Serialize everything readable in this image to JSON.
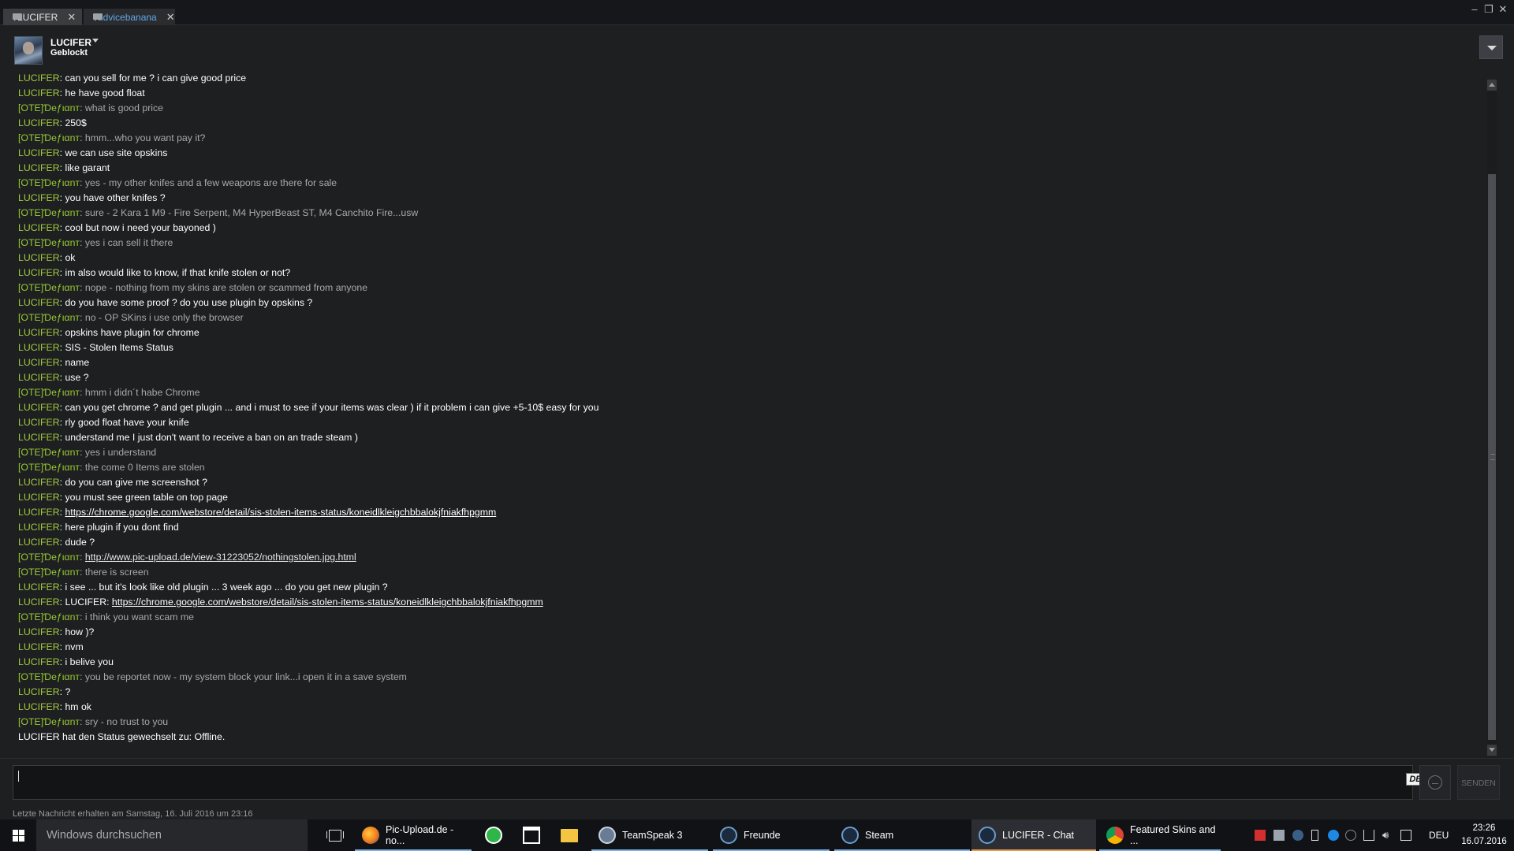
{
  "tabs": [
    {
      "label": "LUCIFER"
    },
    {
      "label": "advicebanana"
    }
  ],
  "header": {
    "name": "LUCIFER",
    "status": "Geblockt"
  },
  "messages": [
    {
      "n": "LUCIFER",
      "t": "can you sell for me ? i can give good price",
      "me": false
    },
    {
      "n": "LUCIFER",
      "t": "he have good float",
      "me": false
    },
    {
      "n": "[OTE]Ɗeƒιαnт",
      "t": "what is good price",
      "me": true
    },
    {
      "n": "LUCIFER",
      "t": "250$",
      "me": false
    },
    {
      "n": "[OTE]Ɗeƒιαnт",
      "t": "hmm...who you want pay it?",
      "me": true
    },
    {
      "n": "LUCIFER",
      "t": "we can use site opskins",
      "me": false
    },
    {
      "n": "LUCIFER",
      "t": "like garant",
      "me": false
    },
    {
      "n": "[OTE]Ɗeƒιαnт",
      "t": "yes - my other knifes and a few weapons are there for sale",
      "me": true
    },
    {
      "n": "LUCIFER",
      "t": "you have other knifes ?",
      "me": false
    },
    {
      "n": "[OTE]Ɗeƒιαnт",
      "t": "sure - 2 Kara 1 M9 - Fire Serpent, M4 HyperBeast ST, M4 Canchito Fire...usw",
      "me": true
    },
    {
      "n": "LUCIFER",
      "t": "cool but now i need your bayoned )",
      "me": false
    },
    {
      "n": "[OTE]Ɗeƒιαnт",
      "t": "yes i can sell it there",
      "me": true
    },
    {
      "n": "LUCIFER",
      "t": "ok",
      "me": false
    },
    {
      "n": "LUCIFER",
      "t": "im also would like to know, if that knife stolen or not?",
      "me": false
    },
    {
      "n": "[OTE]Ɗeƒιαnт",
      "t": "nope - nothing from my skins are stolen or scammed from anyone",
      "me": true
    },
    {
      "n": "LUCIFER",
      "t": "do you have some proof ? do you use plugin by opskins ?",
      "me": false
    },
    {
      "n": "[OTE]Ɗeƒιαnт",
      "t": "no - OP SKins i use only the browser",
      "me": true
    },
    {
      "n": "LUCIFER",
      "t": "opskins have plugin for chrome",
      "me": false
    },
    {
      "n": "LUCIFER",
      "t": "SIS - Stolen Items Status",
      "me": false
    },
    {
      "n": "LUCIFER",
      "t": "name",
      "me": false
    },
    {
      "n": "LUCIFER",
      "t": "use ?",
      "me": false
    },
    {
      "n": "[OTE]Ɗeƒιαnт",
      "t": "hmm i didn´t habe Chrome",
      "me": true
    },
    {
      "n": "LUCIFER",
      "t": "can you get chrome ? and get plugin ... and i must to see if your items was clear ) if it problem i can give +5-10$ easy for you",
      "me": false
    },
    {
      "n": "LUCIFER",
      "t": "rly good float have your knife",
      "me": false
    },
    {
      "n": "LUCIFER",
      "t": "understand me I just don't want to receive a ban on an trade steam )",
      "me": false
    },
    {
      "n": "[OTE]Ɗeƒιαnт",
      "t": "yes i understand",
      "me": true
    },
    {
      "n": "[OTE]Ɗeƒιαnт",
      "t": "the come 0 Items are stolen",
      "me": true
    },
    {
      "n": "LUCIFER",
      "t": "do you can give me screenshot ?",
      "me": false
    },
    {
      "n": "LUCIFER",
      "t": "you must see green table on top page",
      "me": false
    },
    {
      "n": "LUCIFER",
      "t": "",
      "link": "https://chrome.google.com/webstore/detail/sis-stolen-items-status/koneidlkleigchbbalokjfniakfhpgmm",
      "me": false
    },
    {
      "n": "LUCIFER",
      "t": "here plugin if you dont find",
      "me": false
    },
    {
      "n": "LUCIFER",
      "t": "dude ?",
      "me": false
    },
    {
      "n": "[OTE]Ɗeƒιαnт",
      "t": "",
      "link": "http://www.pic-upload.de/view-31223052/nothingstolen.jpg.html",
      "me": true
    },
    {
      "n": "[OTE]Ɗeƒιαnт",
      "t": "there is screen",
      "me": true
    },
    {
      "n": "LUCIFER",
      "t": "i see ... but it's look like old plugin ... 3 week ago ... do you get new plugin ?",
      "me": false
    },
    {
      "n": "LUCIFER",
      "t": "LUCIFER: ",
      "link": "https://chrome.google.com/webstore/detail/sis-stolen-items-status/koneidlkleigchbbalokjfniakfhpgmm",
      "me": false
    },
    {
      "n": "[OTE]Ɗeƒιαnт",
      "t": "i think you want scam me",
      "me": true
    },
    {
      "n": "LUCIFER",
      "t": "how )?",
      "me": false
    },
    {
      "n": "LUCIFER",
      "t": "nvm",
      "me": false
    },
    {
      "n": "LUCIFER",
      "t": "i belive you",
      "me": false
    },
    {
      "n": "[OTE]Ɗeƒιαnт",
      "t": "you be reportet now - my system block your link...i open it in a save system",
      "me": true
    },
    {
      "n": "LUCIFER",
      "t": "?",
      "me": false
    },
    {
      "n": "LUCIFER",
      "t": "hm ok",
      "me": false
    },
    {
      "n": "[OTE]Ɗeƒιαnт",
      "t": "sry - no trust to you",
      "me": true
    }
  ],
  "status_line": "LUCIFER hat den Status gewechselt zu: Offline.",
  "input": {
    "value": "",
    "lang": "DE",
    "send_label": "SENDEN"
  },
  "last_message": "Letzte Nachricht erhalten am Samstag, 16. Juli 2016 um 23:16",
  "taskbar": {
    "search_placeholder": "Windows durchsuchen",
    "items": [
      {
        "label": "Pic-Upload.de - no...",
        "icon": "firefox-icon",
        "color": "#e8661b"
      },
      {
        "label": "TeamSpeak 3",
        "icon": "teamspeak-icon",
        "color": "#6a7c93"
      },
      {
        "label": "Freunde",
        "icon": "steam-icon",
        "color": "#2a5a86"
      },
      {
        "label": "Steam",
        "icon": "steam-icon",
        "color": "#2a5a86"
      },
      {
        "label": "LUCIFER - Chat",
        "icon": "steam-icon",
        "color": "#2a5a86"
      },
      {
        "label": "Featured Skins and ...",
        "icon": "chrome-icon",
        "color": "#dd4b39"
      }
    ],
    "language": "DEU",
    "time": "23:26",
    "date": "16.07.2016"
  }
}
